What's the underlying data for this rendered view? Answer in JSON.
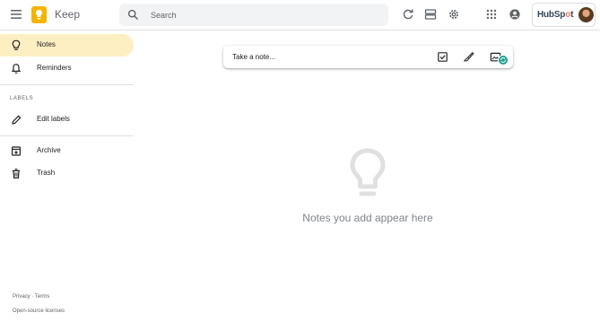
{
  "header": {
    "app_title": "Keep",
    "search_placeholder": "Search",
    "brand_text_a": "HubSp",
    "brand_text_o": "o",
    "brand_text_b": "t"
  },
  "sidebar": {
    "items": [
      {
        "label": "Notes",
        "icon": "lightbulb-icon",
        "active": true
      },
      {
        "label": "Reminders",
        "icon": "bell-icon",
        "active": false
      },
      {
        "label": "Edit labels",
        "icon": "pencil-icon",
        "active": false
      },
      {
        "label": "Archive",
        "icon": "archive-icon",
        "active": false
      },
      {
        "label": "Trash",
        "icon": "trash-icon",
        "active": false
      }
    ],
    "section_label": "LABELS",
    "footer": {
      "privacy": "Privacy",
      "separator": "·",
      "terms": "Terms",
      "licenses": "Open-source licenses"
    }
  },
  "note_bar": {
    "placeholder": "Take a note..."
  },
  "empty_state": {
    "message": "Notes you add appear here"
  },
  "colors": {
    "accent_yellow": "#f6b400",
    "active_nav_bg": "#feefc3",
    "badge_green": "#1ca38a",
    "hubspot_orange": "#ff7a59"
  }
}
